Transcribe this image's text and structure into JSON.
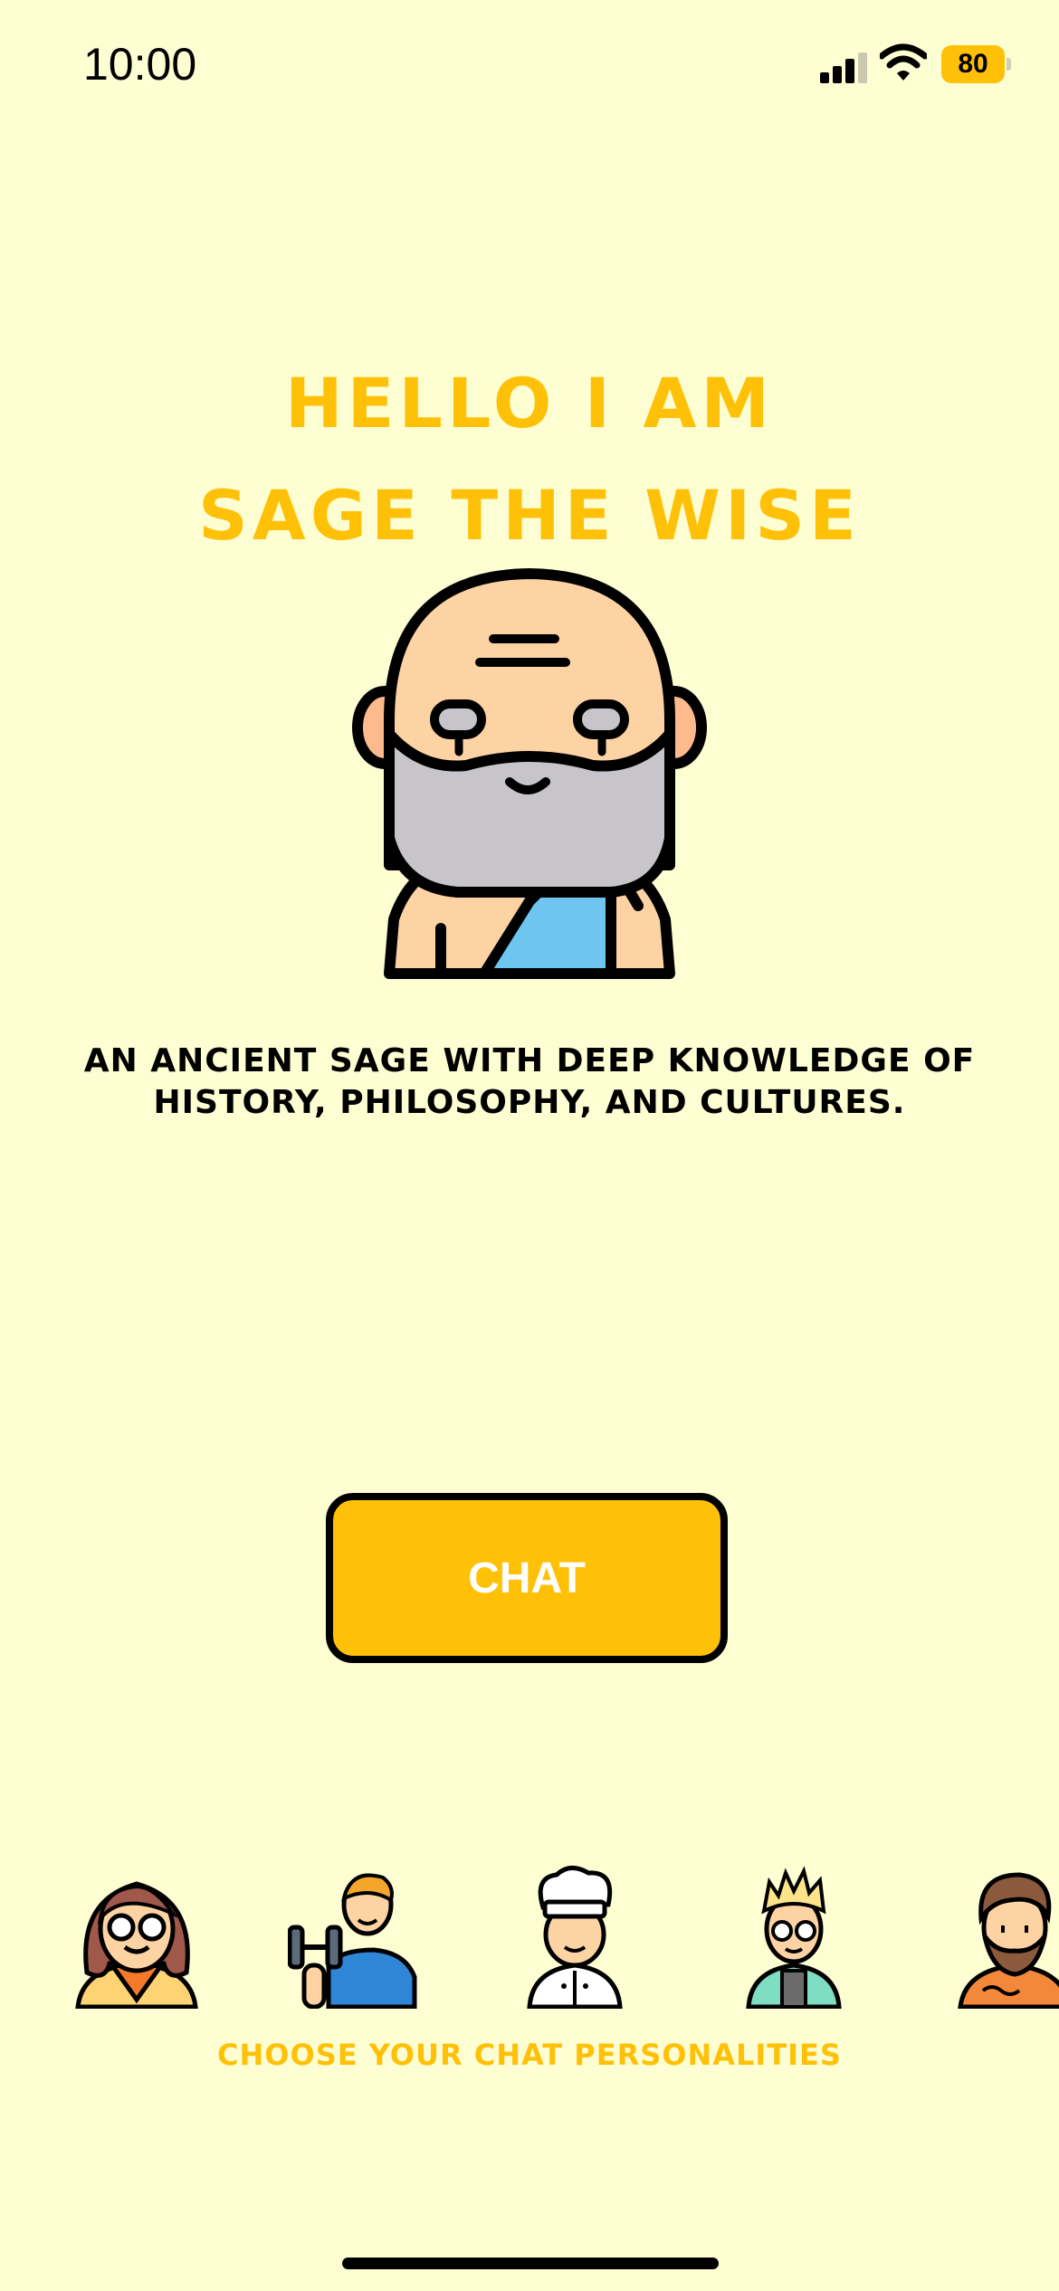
{
  "status_bar": {
    "time": "10:00",
    "battery_level": "80",
    "signal_icon": "cellular-signal-icon",
    "wifi_icon": "wifi-icon"
  },
  "hero": {
    "title_line1": "HELLO I AM",
    "title_line2": "SAGE THE WISE",
    "avatar_icon": "sage-avatar-icon",
    "description_line1": "AN ANCIENT SAGE WITH DEEP KNOWLEDGE OF",
    "description_line2": "HISTORY, PHILOSOPHY, AND CULTURES."
  },
  "chat_button": {
    "label": "CHAT"
  },
  "personalities": {
    "label": "CHOOSE YOUR CHAT PERSONALITIES",
    "items": [
      {
        "icon": "woman-with-glasses-avatar-icon"
      },
      {
        "icon": "fitness-trainer-avatar-icon"
      },
      {
        "icon": "chef-avatar-icon"
      },
      {
        "icon": "scientist-avatar-icon"
      },
      {
        "icon": "bearded-man-avatar-icon"
      }
    ]
  },
  "colors": {
    "background": "#FEFED3",
    "accent": "#FFC107",
    "text": "#000000",
    "button_text": "#FFFFFF"
  }
}
